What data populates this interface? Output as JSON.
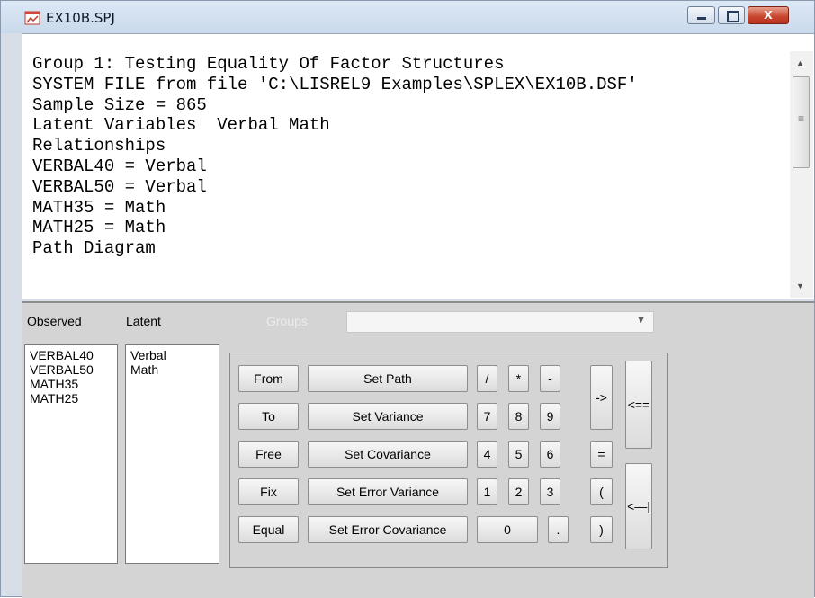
{
  "window": {
    "title": "EX10B.SPJ",
    "close_glyph": "x"
  },
  "editor": {
    "lines": [
      "Group 1: Testing Equality Of Factor Structures",
      "SYSTEM FILE from file 'C:\\LISREL9 Examples\\SPLEX\\EX10B.DSF'",
      "Sample Size = 865",
      "Latent Variables  Verbal Math",
      "Relationships",
      "VERBAL40 = Verbal",
      "VERBAL50 = Verbal",
      "MATH35 = Math",
      "MATH25 = Math",
      "Path Diagram"
    ]
  },
  "panel": {
    "observed_label": "Observed",
    "latent_label": "Latent",
    "groups_label": "Groups",
    "groups_value": "",
    "observed": [
      "VERBAL40",
      "VERBAL50",
      "MATH35",
      "MATH25"
    ],
    "latent": [
      "Verbal",
      "Math"
    ]
  },
  "keypad": {
    "from": "From",
    "to": "To",
    "free": "Free",
    "fix": "Fix",
    "equal": "Equal",
    "set_path": "Set Path",
    "set_variance": "Set Variance",
    "set_covariance": "Set Covariance",
    "set_error_variance": "Set Error Variance",
    "set_error_covariance": "Set Error Covariance",
    "slash": "/",
    "star": "*",
    "minus": "-",
    "d7": "7",
    "d8": "8",
    "d9": "9",
    "d4": "4",
    "d5": "5",
    "d6": "6",
    "d1": "1",
    "d2": "2",
    "d3": "3",
    "d0": "0",
    "dot": ".",
    "arrow": "->",
    "equals": "=",
    "lparen": "(",
    "rparen": ")",
    "back_all": "<==",
    "back_one": "<—|"
  }
}
